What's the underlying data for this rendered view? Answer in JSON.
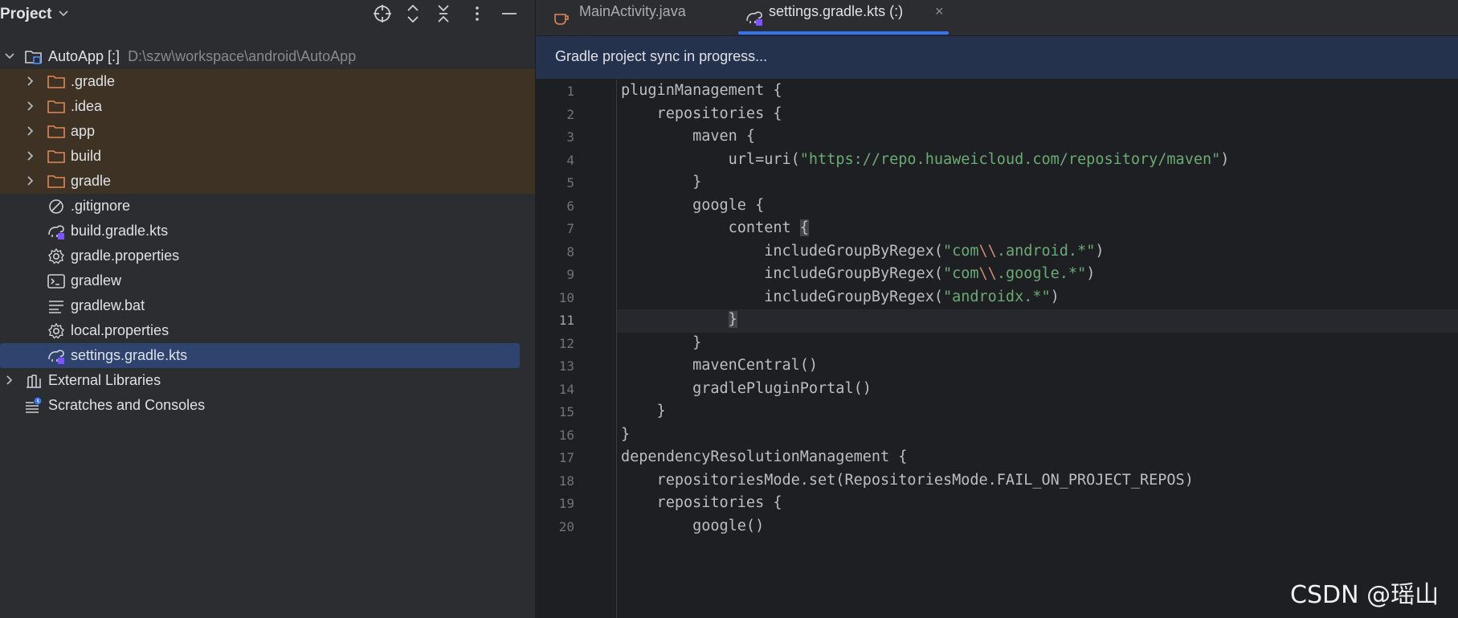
{
  "project_panel": {
    "title": "Project",
    "header_icons": [
      "crosshair-icon",
      "expand-all-icon",
      "collapse-all-icon",
      "more-icon",
      "minimize-icon"
    ]
  },
  "tree": {
    "root": {
      "label": "AutoApp [:]",
      "path": "D:\\szw\\workspace\\android\\AutoApp"
    },
    "items": [
      {
        "label": ".gradle",
        "icon": "folder-icon"
      },
      {
        "label": ".idea",
        "icon": "folder-icon"
      },
      {
        "label": "app",
        "icon": "folder-icon"
      },
      {
        "label": "build",
        "icon": "folder-icon"
      },
      {
        "label": "gradle",
        "icon": "folder-icon"
      },
      {
        "label": ".gitignore",
        "icon": "ignore-file-icon"
      },
      {
        "label": "build.gradle.kts",
        "icon": "gradle-kts-icon"
      },
      {
        "label": "gradle.properties",
        "icon": "settings-gear-icon"
      },
      {
        "label": "gradlew",
        "icon": "terminal-icon"
      },
      {
        "label": "gradlew.bat",
        "icon": "text-lines-icon"
      },
      {
        "label": "local.properties",
        "icon": "settings-gear-icon"
      },
      {
        "label": "settings.gradle.kts",
        "icon": "gradle-kts-icon"
      }
    ],
    "external": "External Libraries",
    "scratches": "Scratches and Consoles"
  },
  "tabs": [
    {
      "label": "MainActivity.java",
      "icon": "java-cup-icon"
    },
    {
      "label": "settings.gradle.kts (:)",
      "icon": "gradle-kts-icon",
      "close": "×"
    }
  ],
  "sync_banner": "Gradle project sync in progress...",
  "editor": {
    "current_line": 11,
    "line_numbers": [
      "1",
      "2",
      "3",
      "4",
      "5",
      "6",
      "7",
      "8",
      "9",
      "10",
      "11",
      "12",
      "13",
      "14",
      "15",
      "16",
      "17",
      "18",
      "19",
      "20"
    ],
    "lines": [
      [
        {
          "t": "pluginManagement {"
        }
      ],
      [
        {
          "t": "    repositories {"
        }
      ],
      [
        {
          "t": "        maven {"
        }
      ],
      [
        {
          "t": "            url=uri("
        },
        {
          "t": "\"https://repo.huaweicloud.com/repository/maven\"",
          "c": "str"
        },
        {
          "t": ")"
        }
      ],
      [
        {
          "t": "        }"
        }
      ],
      [
        {
          "t": "        google {"
        }
      ],
      [
        {
          "t": "            content "
        },
        {
          "t": "{",
          "c": "brace-hl"
        }
      ],
      [
        {
          "t": "                includeGroupByRegex("
        },
        {
          "t": "\"com",
          "c": "str"
        },
        {
          "t": "\\\\",
          "c": "esc"
        },
        {
          "t": ".android.*\"",
          "c": "str"
        },
        {
          "t": ")"
        }
      ],
      [
        {
          "t": "                includeGroupByRegex("
        },
        {
          "t": "\"com",
          "c": "str"
        },
        {
          "t": "\\\\",
          "c": "esc"
        },
        {
          "t": ".google.*\"",
          "c": "str"
        },
        {
          "t": ")"
        }
      ],
      [
        {
          "t": "                includeGroupByRegex("
        },
        {
          "t": "\"androidx.*\"",
          "c": "str"
        },
        {
          "t": ")"
        }
      ],
      [
        {
          "t": "            "
        },
        {
          "t": "}",
          "c": "brace-hl"
        }
      ],
      [
        {
          "t": "        }"
        }
      ],
      [
        {
          "t": "        mavenCentral()"
        }
      ],
      [
        {
          "t": "        gradlePluginPortal()"
        }
      ],
      [
        {
          "t": "    }"
        }
      ],
      [
        {
          "t": "}"
        }
      ],
      [
        {
          "t": "dependencyResolutionManagement {"
        }
      ],
      [
        {
          "t": "    repositoriesMode.set(RepositoriesMode.FAIL_ON_PROJECT_REPOS)"
        }
      ],
      [
        {
          "t": "    repositories {"
        }
      ],
      [
        {
          "t": "        google()"
        }
      ]
    ]
  },
  "watermark": "CSDN @瑶山",
  "colors": {
    "panel_bg": "#2b2d30",
    "editor_bg": "#1e1f22",
    "excluded_bg": "#3e3225",
    "selected_bg": "#2e436e",
    "string": "#6aab73",
    "escape": "#cf8e6d",
    "folder": "#e08855"
  }
}
